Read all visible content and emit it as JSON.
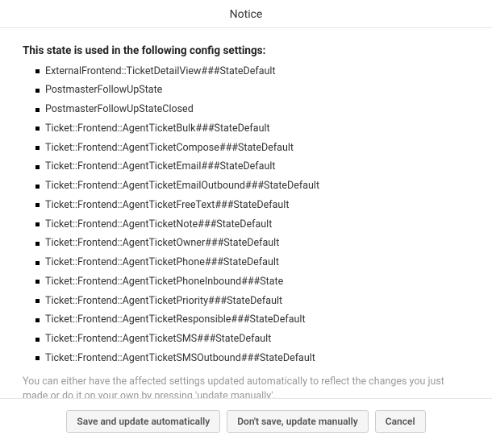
{
  "dialog": {
    "title": "Notice",
    "intro": "This state is used in the following config settings:",
    "note": "You can either have the affected settings updated automatically to reflect the changes you just made or do it on your own by pressing 'update manually'.",
    "items": [
      "ExternalFrontend::TicketDetailView###StateDefault",
      "PostmasterFollowUpState",
      "PostmasterFollowUpStateClosed",
      "Ticket::Frontend::AgentTicketBulk###StateDefault",
      "Ticket::Frontend::AgentTicketCompose###StateDefault",
      "Ticket::Frontend::AgentTicketEmail###StateDefault",
      "Ticket::Frontend::AgentTicketEmailOutbound###StateDefault",
      "Ticket::Frontend::AgentTicketFreeText###StateDefault",
      "Ticket::Frontend::AgentTicketNote###StateDefault",
      "Ticket::Frontend::AgentTicketOwner###StateDefault",
      "Ticket::Frontend::AgentTicketPhone###StateDefault",
      "Ticket::Frontend::AgentTicketPhoneInbound###State",
      "Ticket::Frontend::AgentTicketPriority###StateDefault",
      "Ticket::Frontend::AgentTicketResponsible###StateDefault",
      "Ticket::Frontend::AgentTicketSMS###StateDefault",
      "Ticket::Frontend::AgentTicketSMSOutbound###StateDefault"
    ],
    "buttons": {
      "save": "Save and update automatically",
      "dont_save": "Don't save, update manually",
      "cancel": "Cancel"
    }
  }
}
